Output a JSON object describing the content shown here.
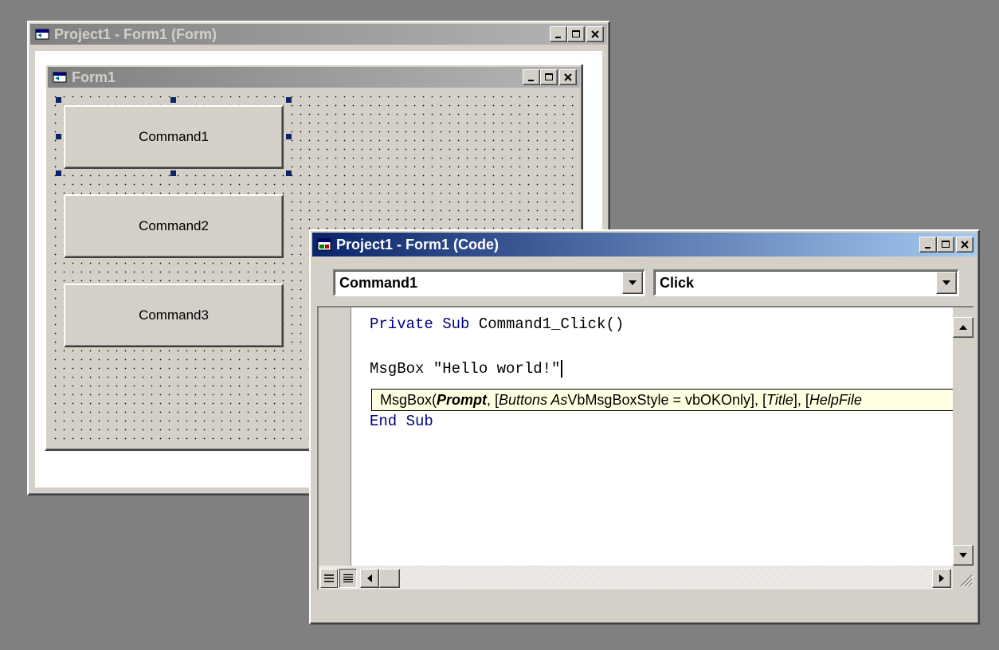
{
  "designer_window": {
    "title": "Project1 - Form1 (Form)"
  },
  "form_window": {
    "title": "Form1",
    "buttons": [
      {
        "label": "Command1"
      },
      {
        "label": "Command2"
      },
      {
        "label": "Command3"
      }
    ]
  },
  "code_window": {
    "title": "Project1 - Form1 (Code)",
    "object_combo": "Command1",
    "procedure_combo": "Click",
    "code": {
      "line1_kw": "Private Sub ",
      "line1_rest": "Command1_Click()",
      "line2": "MsgBox \"Hello world!\"",
      "line3": "End Sub"
    },
    "tooltip": {
      "prefix": "MsgBox(",
      "prompt": "Prompt",
      "sep1": ", [",
      "buttons_as": "Buttons As",
      "type_default": " VbMsgBoxStyle = vbOKOnly], [",
      "title": "Title",
      "sep2": "], [",
      "helpfile": "HelpFile"
    }
  },
  "colors": {
    "desktop": "#808080",
    "face": "#d4d0c8",
    "active_title": "#0a246a",
    "inactive_title": "#808080",
    "keyword": "#000080",
    "tooltip_bg": "#ffffe1"
  }
}
